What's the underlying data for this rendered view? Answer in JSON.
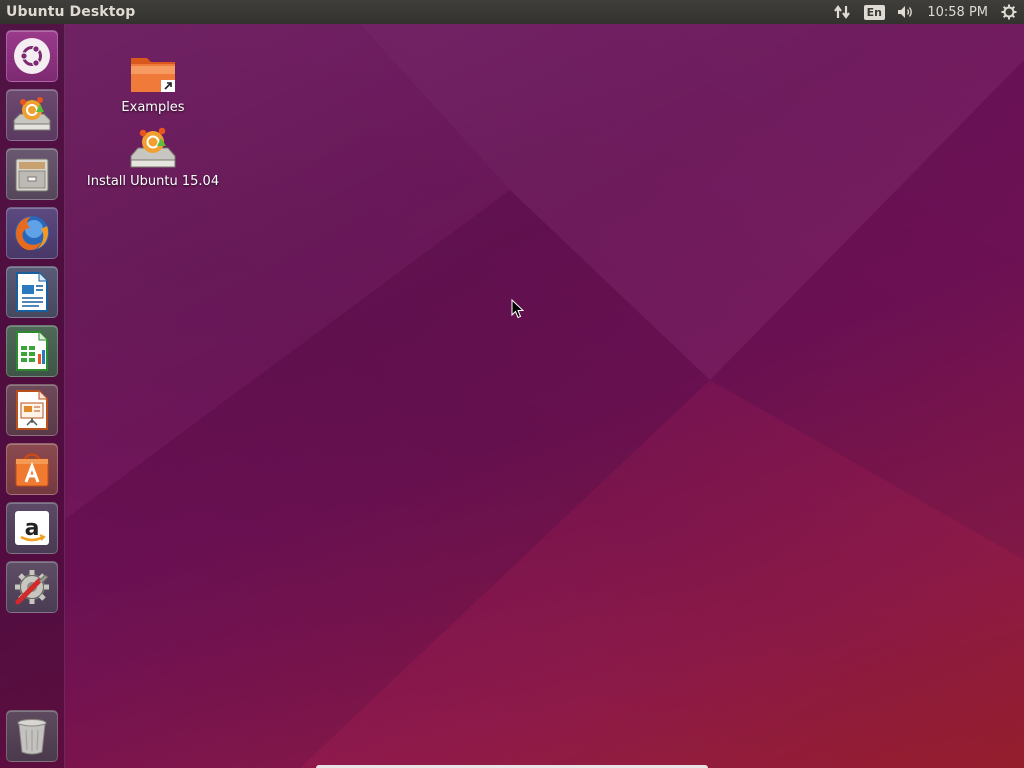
{
  "topbar": {
    "title": "Ubuntu Desktop",
    "language": "En",
    "clock": "10:58 PM",
    "icons": [
      "network-arrows-icon",
      "keyboard-language-icon",
      "volume-icon",
      "session-gear-icon"
    ]
  },
  "launcher": {
    "items": [
      {
        "name": "dash-home",
        "icon": "ubuntu-logo-icon"
      },
      {
        "name": "install-ubuntu",
        "icon": "installer-drive-icon"
      },
      {
        "name": "files",
        "icon": "file-cabinet-icon"
      },
      {
        "name": "firefox",
        "icon": "firefox-icon"
      },
      {
        "name": "libreoffice-writer",
        "icon": "writer-document-icon"
      },
      {
        "name": "libreoffice-calc",
        "icon": "calc-spreadsheet-icon"
      },
      {
        "name": "libreoffice-impress",
        "icon": "impress-presentation-icon"
      },
      {
        "name": "ubuntu-software-center",
        "icon": "software-bag-icon"
      },
      {
        "name": "amazon",
        "icon": "amazon-icon"
      },
      {
        "name": "system-settings",
        "icon": "settings-tools-icon"
      },
      {
        "name": "trash",
        "icon": "trash-icon"
      }
    ]
  },
  "desktop": {
    "icons": [
      {
        "label": "Examples",
        "icon": "folder-link-icon"
      },
      {
        "label": "Install Ubuntu 15.04",
        "icon": "installer-drive-icon"
      }
    ]
  },
  "colors": {
    "panel": "#3c3b37",
    "wallpaper_top": "#6c1560",
    "wallpaper_bottom_right": "#9c1f2e",
    "ubuntu_orange": "#e95420"
  }
}
